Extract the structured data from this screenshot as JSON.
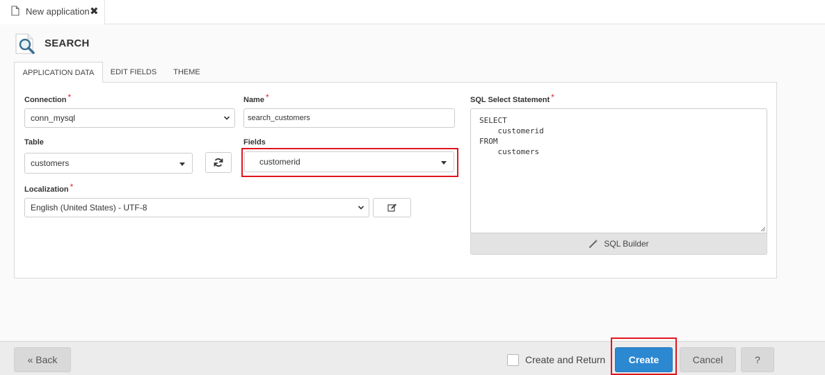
{
  "window": {
    "tab_label": "New application",
    "close_symbol": "✖"
  },
  "header": {
    "title": "SEARCH"
  },
  "tabs": [
    {
      "label": "APPLICATION DATA",
      "active": true
    },
    {
      "label": "EDIT FIELDS",
      "active": false
    },
    {
      "label": "THEME",
      "active": false
    }
  ],
  "form": {
    "connection": {
      "label": "Connection",
      "required": "*",
      "value": "conn_mysql"
    },
    "name": {
      "label": "Name",
      "required": "*",
      "value": "search_customers"
    },
    "table": {
      "label": "Table",
      "value": "customers"
    },
    "fields": {
      "label": "Fields",
      "value": "customerid"
    },
    "localization": {
      "label": "Localization",
      "required": "*",
      "value": "English (United States) - UTF-8"
    },
    "sql": {
      "label": "SQL Select Statement",
      "required": "*",
      "value": "SELECT\n    customerid\nFROM\n    customers",
      "builder_label": "SQL Builder"
    }
  },
  "footer": {
    "back_label": "« Back",
    "create_and_return_label": "Create and Return",
    "create_label": "Create",
    "cancel_label": "Cancel",
    "help_label": "?"
  },
  "colors": {
    "primary": "#2d88d2",
    "highlight": "#e0141e",
    "required": "#d9242a"
  },
  "icons": [
    "document-icon",
    "close-icon",
    "search-icon",
    "chevron-down-icon",
    "refresh-icon",
    "edit-icon",
    "magic-wand-icon"
  ]
}
